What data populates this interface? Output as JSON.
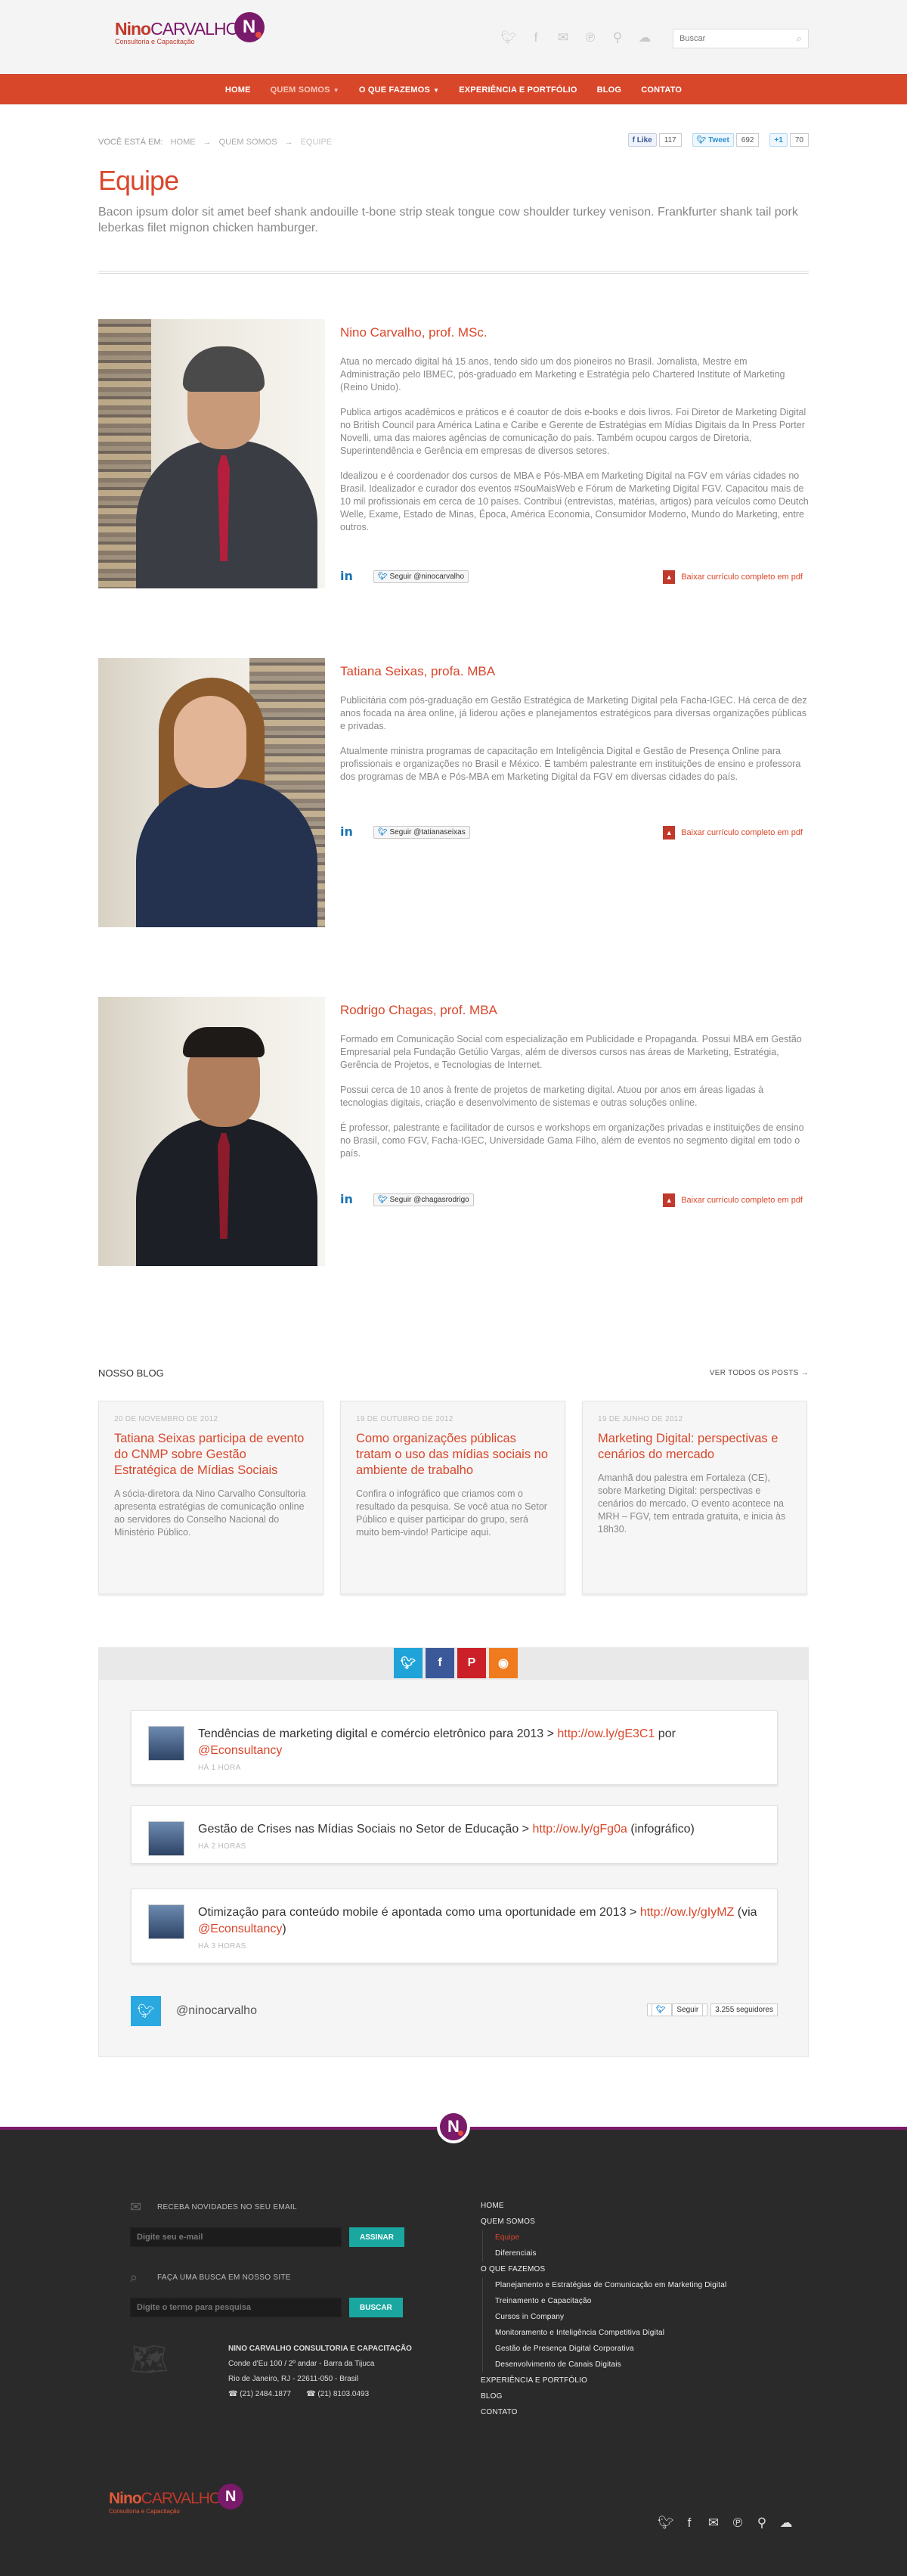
{
  "header": {
    "logo_nino": "Nino",
    "logo_carvalho": "CARVALHO",
    "logo_tagline": "Consultoria e Capacitação",
    "logo_badge": "N",
    "social_icons": [
      "twitter-icon",
      "facebook-icon",
      "blogger-icon",
      "pinterest-icon",
      "foursquare-icon",
      "soundcloud-icon"
    ],
    "search_placeholder": "Buscar",
    "search_icon": "search-icon"
  },
  "nav": {
    "items": [
      {
        "label": "HOME"
      },
      {
        "label": "QUEM SOMOS",
        "active": true
      },
      {
        "label": "O QUE FAZEMOS"
      },
      {
        "label": "EXPERIÊNCIA E PORTFÓLIO"
      },
      {
        "label": "BLOG"
      },
      {
        "label": "CONTATO"
      }
    ]
  },
  "breadcrumb": {
    "label": "VOCÊ ESTÁ EM:",
    "items": [
      "HOME",
      "QUEM SOMOS",
      "EQUIPE"
    ],
    "sep": "→"
  },
  "shares": {
    "facebook": {
      "label": "Like",
      "count": "117"
    },
    "twitter": {
      "label": "Tweet",
      "count": "692"
    },
    "gplus": {
      "label": "+1",
      "count": "70"
    }
  },
  "page": {
    "title": "Equipe",
    "lead": "Bacon ipsum dolor sit amet beef shank andouille t-bone strip steak tongue cow shoulder turkey venison. Frankfurter shank tail pork leberkas filet mignon chicken hamburger."
  },
  "team": [
    {
      "name": "Nino Carvalho, prof. MSc.",
      "bio": [
        "Atua no mercado digital há 15 anos, tendo sido um dos pioneiros no Brasil. Jornalista, Mestre em Administração pelo IBMEC, pós-graduado em Marketing e Estratégia pelo Chartered Institute of Marketing (Reino Unido).",
        "Publica artigos acadêmicos e práticos e é coautor de dois e-books e dois livros. Foi Diretor de Marketing Digital no British Council para América Latina e Caribe e Gerente de Estratégias em Mídias Digitais da In Press Porter Novelli, uma das maiores agências de comunicação do país. Também ocupou cargos de Diretoria, Superintendência e Gerência em empresas de diversos setores.",
        "Idealizou e é coordenador dos cursos de MBA e Pós-MBA em Marketing Digital na FGV em várias cidades no Brasil. Idealizador e curador dos eventos #SouMaisWeb e Fórum de Marketing Digital FGV. Capacitou mais de 10 mil profissionais em cerca de 10 países. Contribui (entrevistas, matérias, artigos) para veículos como Deutch Welle, Exame, Estado de Minas, Época, América Economia, Consumidor Moderno, Mundo do Marketing, entre outros."
      ],
      "follow": "Seguir @ninocarvalho",
      "pdf": "Baixar currículo completo em pdf"
    },
    {
      "name": "Tatiana Seixas, profa. MBA",
      "bio": [
        "Publicitária com pós-graduação em Gestão Estratégica de Marketing Digital pela Facha-IGEC. Há cerca de dez anos focada na área online, já liderou ações e planejamentos estratégicos para diversas organizações públicas e privadas.",
        "Atualmente ministra programas de capacitação em Inteligência Digital e Gestão de Presença Online para profissionais e organizações no Brasil e México. É também palestrante em instituições de ensino e professora dos programas de MBA e Pós-MBA em Marketing Digital da FGV em diversas cidades do país."
      ],
      "follow": "Seguir @tatianaseixas",
      "pdf": "Baixar currículo completo em pdf"
    },
    {
      "name": "Rodrigo Chagas, prof. MBA",
      "bio": [
        "Formado em Comunicação Social com especialização em Publicidade e Propaganda. Possui MBA em Gestão Empresarial pela Fundação Getúlio Vargas, além de diversos cursos nas áreas de Marketing, Estratégia, Gerência de Projetos, e Tecnologias de Internet.",
        "Possui cerca de 10 anos à frente de projetos de marketing digital. Atuou por anos em áreas ligadas à tecnologias digitais, criação e desenvolvimento de sistemas e outras soluções online.",
        "É professor, palestrante e facilitador de cursos e workshops em organizações privadas e instituições de ensino no Brasil, como FGV, Facha-IGEC, Universidade Gama Filho, além de eventos no segmento digital em todo o país."
      ],
      "follow": "Seguir @chagasrodrigo",
      "pdf": "Baixar currículo completo em pdf"
    }
  ],
  "blog": {
    "heading": "NOSSO BLOG",
    "all_posts": "VER TODOS OS POSTS",
    "posts": [
      {
        "date": "20 DE NOVEMBRO DE 2012",
        "title": "Tatiana Seixas participa de evento do CNMP sobre Gestão Estratégica de Mídias Sociais",
        "excerpt": "A sócia-diretora da Nino Carvalho Consultoria apresenta estratégias de comunicação online ao servidores do Conselho Nacional do Ministério Público."
      },
      {
        "date": "19 DE OUTUBRO DE 2012",
        "title": "Como organizações públicas tratam o uso das mídias sociais no ambiente de trabalho",
        "excerpt": "Confira o infográfico que criamos com o resultado da pesquisa. Se você atua no Setor Público e quiser participar do grupo, será muito bem-vindo! Participe aqui."
      },
      {
        "date": "19 DE JUNHO DE 2012",
        "title": "Marketing Digital: perspectivas e cenários do mercado",
        "excerpt": "Amanhã dou palestra em Fortaleza (CE), sobre Marketing Digital: perspectivas e cenários do mercado. O evento acontece na MRH – FGV, tem entrada gratuita, e inicia às 18h30."
      }
    ]
  },
  "feed": {
    "tabs": [
      "twitter-icon",
      "facebook-icon",
      "pinterest-icon",
      "rss-icon"
    ],
    "tweets": [
      {
        "text": "Tendências de marketing digital e comércio eletrônico para 2013 > ",
        "link": "http://ow.ly/gE3C1",
        "suffix": " por ",
        "mention": "@Econsultancy",
        "tail": "",
        "time": "HÁ 1 HORA"
      },
      {
        "text": "Gestão de Crises nas Mídias Sociais no Setor de Educação > ",
        "link": "http://ow.ly/gFg0a",
        "suffix": " (infográfico)",
        "mention": "",
        "tail": "",
        "time": "HÁ 2 HORAS"
      },
      {
        "text": "Otimização para conteúdo mobile é apontada como uma oportunidade em 2013 > ",
        "link": "http://ow.ly/gIyMZ",
        "suffix": " (via ",
        "mention": "@Econsultancy",
        "tail": ")",
        "time": "HÁ 3 HORAS"
      }
    ],
    "handle": "@ninocarvalho",
    "follow_label": "Seguir",
    "followers": "3.255 seguidores"
  },
  "footer": {
    "newsletter_label": "RECEBA NOVIDADES NO SEU EMAIL",
    "newsletter_placeholder": "Digite seu e-mail",
    "newsletter_button": "ASSINAR",
    "search_label": "FAÇA UMA BUSCA EM NOSSO SITE",
    "search_placeholder": "Digite o termo para pesquisa",
    "search_button": "BUSCAR",
    "company": "NINO CARVALHO CONSULTORIA E CAPACITAÇÃO",
    "address1": "Conde d'Eu 100 / 2º andar - Barra da Tijuca",
    "address2": "Rio de Janeiro, RJ - 22611-050 - Brasil",
    "phone1": "(21) 2484.1877",
    "phone2": "(21) 8103.0493",
    "sitemap": {
      "home": "HOME",
      "quem_somos": "QUEM SOMOS",
      "quem_somos_items": [
        "Equipe",
        "Diferenciais"
      ],
      "o_que_fazemos": "O QUE FAZEMOS",
      "o_que_fazemos_items": [
        "Planejamento e Estratégias de Comunicação em Marketing Digital",
        "Treinamento e Capacitação",
        "Cursos in Company",
        "Monitoramento e Inteligência Competitiva Digital",
        "Gestão de Presença Digital Corporativa",
        "Desenvolvimento de Canais Digitais"
      ],
      "experiencia": "EXPERIÊNCIA E PORTFÓLIO",
      "blog": "BLOG",
      "contato": "CONTATO"
    },
    "social_icons": [
      "twitter-icon",
      "facebook-icon",
      "blogger-icon",
      "pinterest-icon",
      "foursquare-icon",
      "soundcloud-icon"
    ]
  },
  "colors": {
    "accent": "#d9472b",
    "brand_purple": "#7a1a6a",
    "footer_bg": "#2a2a2a",
    "button_teal": "#1aa7a0"
  }
}
